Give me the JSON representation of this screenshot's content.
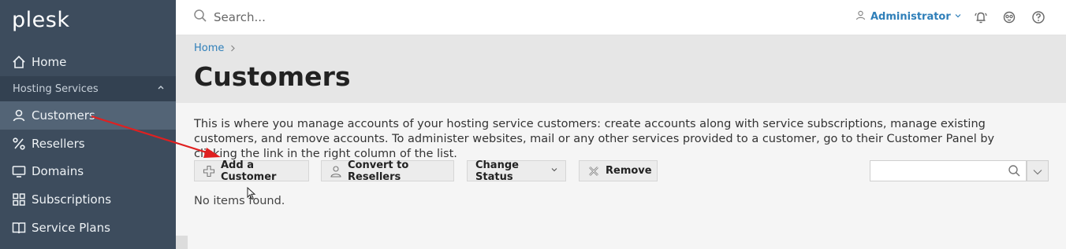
{
  "app": {
    "logo": "plesk"
  },
  "sidebar": {
    "home": "Home",
    "group": "Hosting Services",
    "items": [
      {
        "label": "Customers",
        "icon": "user-icon",
        "active": true
      },
      {
        "label": "Resellers",
        "icon": "percent-icon",
        "active": false
      },
      {
        "label": "Domains",
        "icon": "monitor-icon",
        "active": false
      },
      {
        "label": "Subscriptions",
        "icon": "grid-icon",
        "active": false
      },
      {
        "label": "Service Plans",
        "icon": "book-icon",
        "active": false
      }
    ]
  },
  "topbar": {
    "search_placeholder": "Search...",
    "user": "Administrator"
  },
  "breadcrumb": {
    "home": "Home"
  },
  "page": {
    "title": "Customers",
    "description": "This is where you manage accounts of your hosting service customers: create accounts along with service subscriptions, manage existing customers, and remove accounts. To administer websites, mail or any other services provided to a customer, go to their Customer Panel by clicking the link in the right column of the list.",
    "empty_message": "No items found."
  },
  "toolbar": {
    "add": "Add a Customer",
    "convert": "Convert to Resellers",
    "status": "Change Status",
    "remove": "Remove"
  },
  "colors": {
    "sidebar": "#3d4c5d",
    "link": "#2f7fb9",
    "annotation_arrow": "#e02020"
  }
}
